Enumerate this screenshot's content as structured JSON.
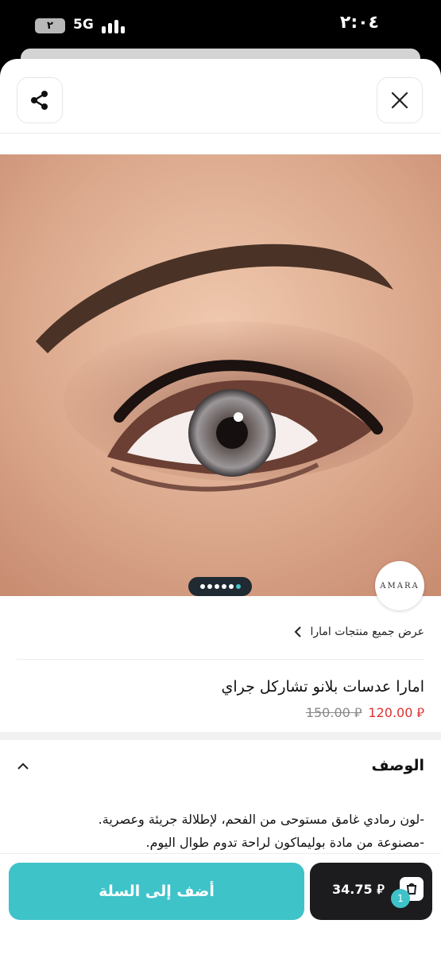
{
  "status_bar": {
    "time": "٢:٠٤",
    "battery_level": "٢",
    "network": "5G"
  },
  "product": {
    "brand_logo_text": "AMARA",
    "view_all_label": "عرض جميع منتجات امارا",
    "title": "امارا عدسات بلانو تشاركل جراي",
    "price_current": "120.00",
    "price_original": "150.00",
    "currency_symbol": "⃁",
    "gallery": {
      "total_images": 6,
      "active_index": 5
    }
  },
  "description": {
    "heading": "الوصف",
    "lines": [
      "-لون رمادي غامق مستوحى من الفحم، لإطلالة جريئة وعصرية.",
      "-مصنوعة من مادة بوليماكون لراحة تدوم طوال اليوم."
    ]
  },
  "footer": {
    "add_to_cart_label": "أضف إلى السلة",
    "cart_total": "34.75",
    "cart_count": "1"
  },
  "icons": {
    "share": "share-icon",
    "close": "close-icon",
    "back_chevron": "chevron-left-icon",
    "collapse": "chevron-up-icon",
    "cart": "shopping-bag-icon"
  },
  "colors": {
    "accent": "#3ec3c9",
    "sale_price": "#e03131",
    "cart_button": "#1c1c1e"
  }
}
